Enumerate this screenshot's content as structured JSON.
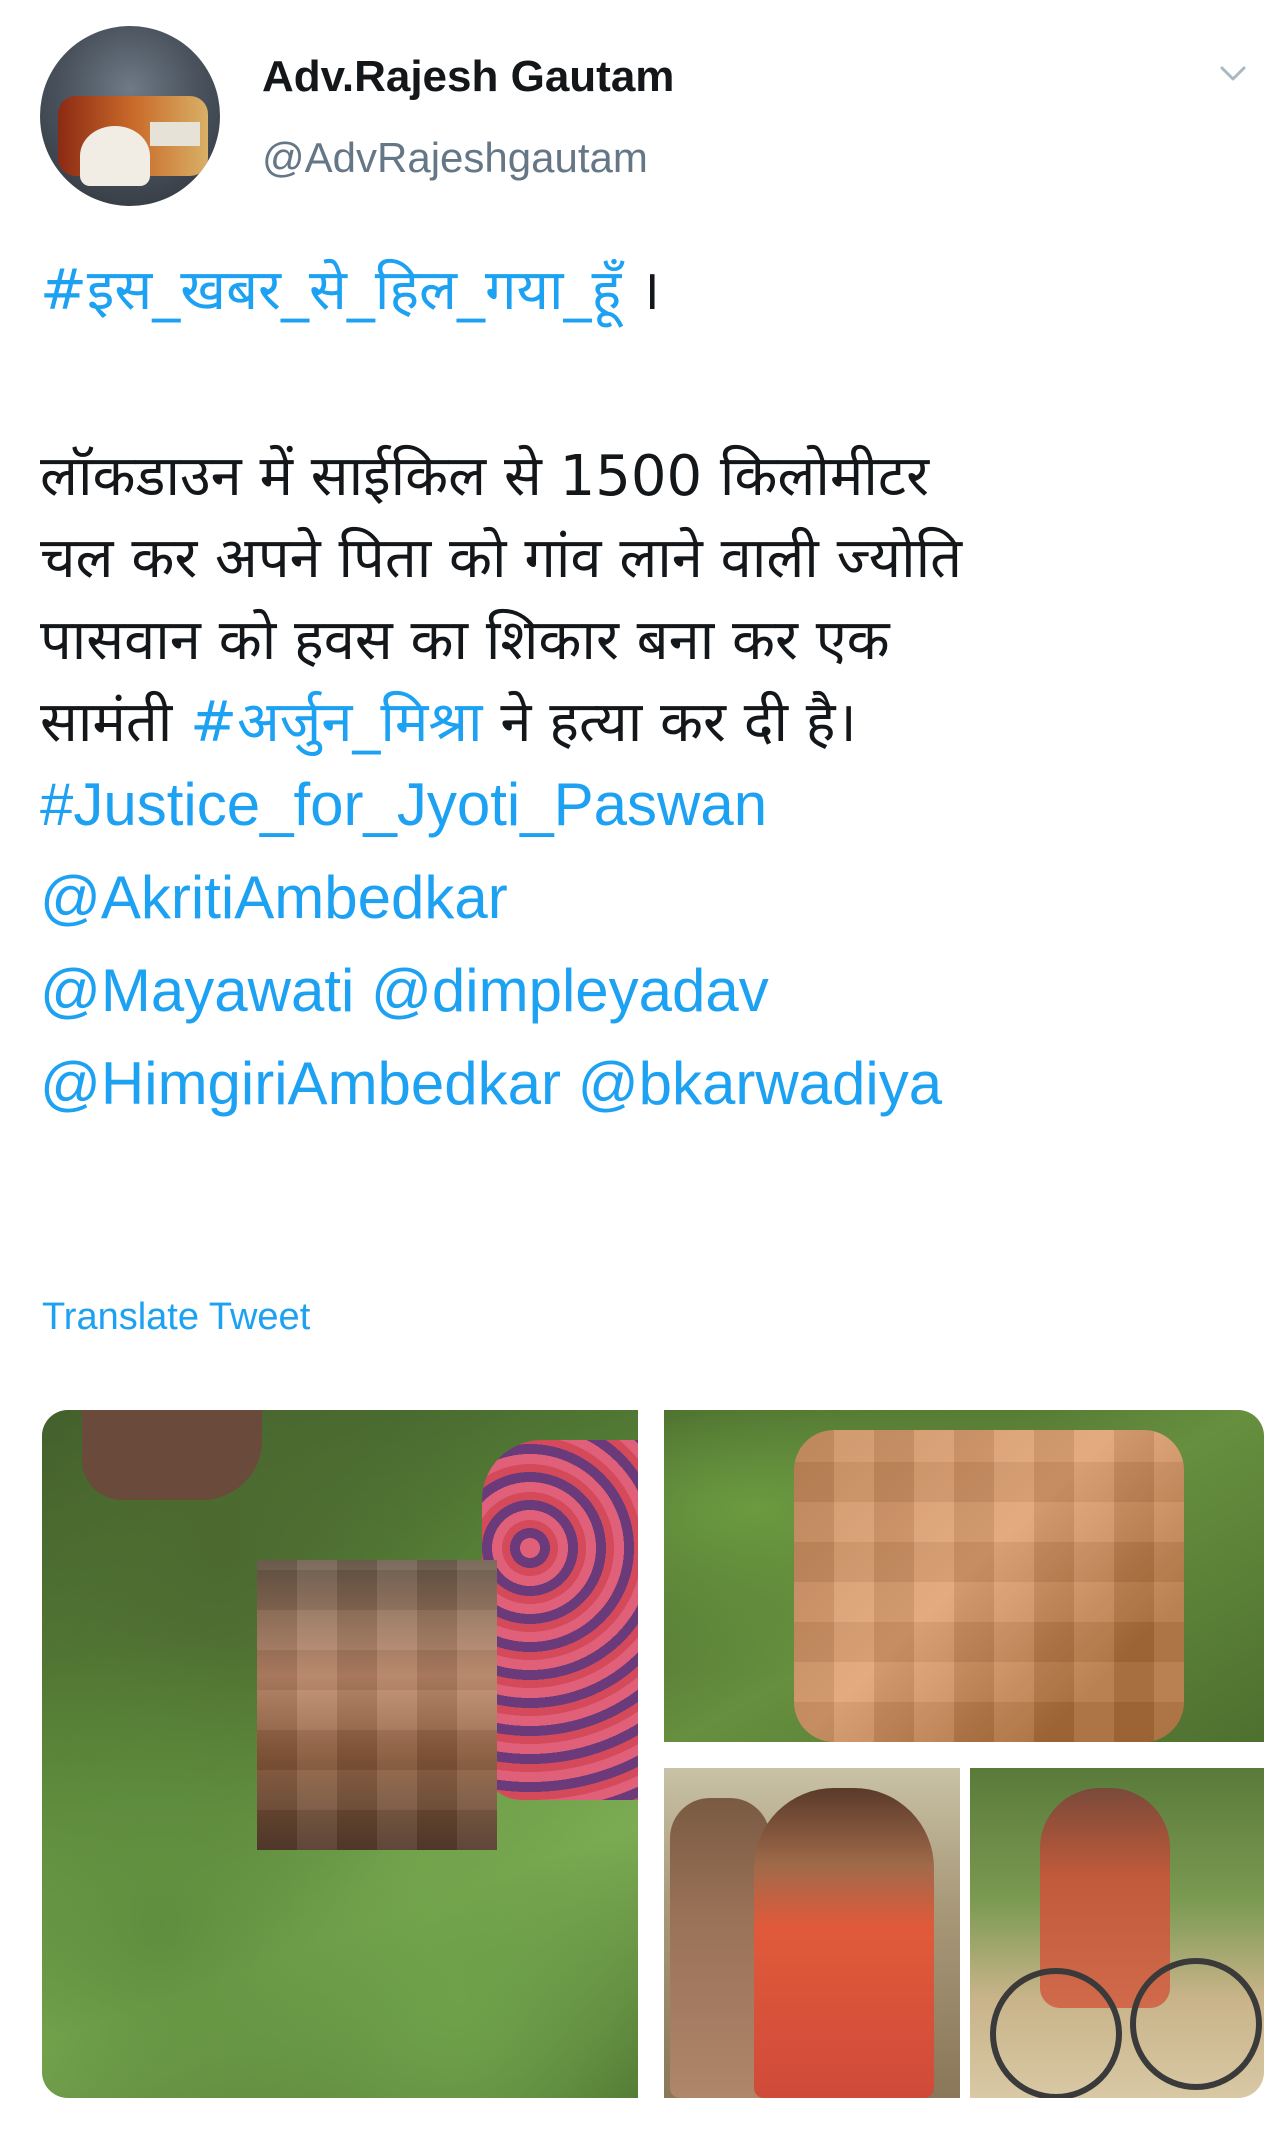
{
  "header": {
    "display_name": "Adv.Rajesh Gautam",
    "handle": "@AdvRajeshgautam",
    "menu_icon": "chevron-down-icon",
    "avatar_icon": "user-avatar-image"
  },
  "tweet": {
    "hashtag_line": "#इस_खबर_से_हिल_गया_हूँ",
    "hashtag_line_suffix": " ।",
    "body_line_1": "लॉकडाउन में साईकिल से 1500 किलोमीटर",
    "body_line_2": "चल कर अपने पिता को गांव लाने वाली ज्योति",
    "body_line_3": "पासवान को हवस का शिकार बना कर एक",
    "body_line_4_prefix": "सामंती ",
    "body_line_4_hashtag": "#अर्जुन_मिश्रा",
    "body_line_4_suffix": " ने हत्या कर दी है।",
    "hashtag_justice": "#Justice_for_Jyoti_Paswan",
    "mention_1": "@AkritiAmbedkar",
    "mention_2": "@Mayawati",
    "mention_3": "@dimpleyadav",
    "mention_4": "@HimgiriAmbedkar",
    "mention_5": "@bkarwadiya"
  },
  "translate_label": "Translate Tweet",
  "colors": {
    "link": "#1da1f2",
    "text": "#14171a",
    "secondary": "#657786"
  }
}
